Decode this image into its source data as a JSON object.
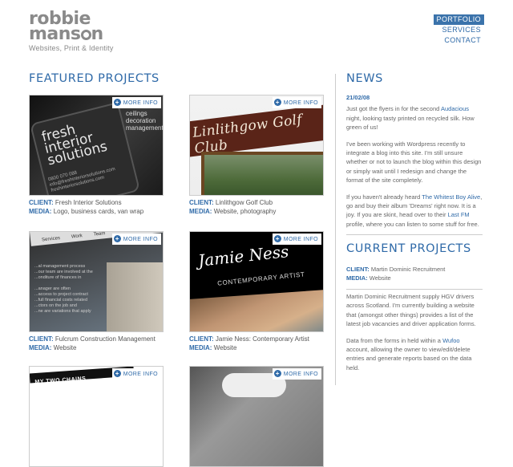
{
  "logo": {
    "line1": "robbie",
    "line2_before": "mans",
    "line2_after": "n",
    "tagline": "Websites, Print & Identity"
  },
  "nav": {
    "items": [
      {
        "label": "PORTFOLIO",
        "active": true
      },
      {
        "label": "SERVICES",
        "active": false
      },
      {
        "label": "CONTACT",
        "active": false
      }
    ]
  },
  "featured": {
    "title": "FEATURED PROJECTS",
    "more_info": "MORE INFO",
    "client_label": "CLIENT:",
    "media_label": "MEDIA:",
    "projects": [
      {
        "client": "Fresh Interior Solutions",
        "media": "Logo, business cards, van wrap",
        "art": {
          "t1": "fresh\ninterior\nsolutions",
          "t2": "0800 070 088\ninfo@freshinteriorsolutions.com\nfreshinteriorsolutions.com",
          "t3": "ceilings\ndecoration\nmanagement"
        }
      },
      {
        "client": "Linlithgow Golf Club",
        "media": "Website, photography",
        "art": {
          "script": "Linlithgow Golf Club"
        }
      },
      {
        "client": "Fulcrum Construction Management",
        "media": "Website",
        "art": {
          "tabs": [
            "Services",
            "Work",
            "Team"
          ],
          "lines": "...al management process\n...our team are involved at the\n...onditure of finances in\n\n...anager are often\n...access to project contract\n...full financial costs related\n...ctors on the job and\n...ne are variations that apply"
        }
      },
      {
        "client": "Jamie Ness: Contemporary Artist",
        "media": "Website",
        "art": {
          "sig": "Jamie Ness",
          "sub": "CONTEMPORARY ARTIST"
        }
      },
      {
        "art": {
          "stripe": "MY TWO CHAINS"
        }
      },
      {
        "art": {}
      }
    ]
  },
  "news": {
    "title": "NEWS",
    "date": "21/02/08",
    "p1_a": "Just got the flyers in for the second ",
    "p1_link": "Audacious",
    "p1_b": " night, looking tasty printed on recycled silk. How green of us!",
    "p2": "I've been working with Wordpress recently to integrate a blog into this site. I'm still unsure whether or not to launch the blog within this design or simply wait until I redesign and change the format of the site completely.",
    "p3_a": "If you haven't already heard ",
    "p3_link1": "The Whitest Boy Alive",
    "p3_b": ", go and buy their album 'Dreams' right now. It is a joy. If you are skint, head over to their ",
    "p3_link2": "Last FM",
    "p3_c": " profile, where you can listen to some stuff for free."
  },
  "current": {
    "title": "CURRENT PROJECTS",
    "client_label": "CLIENT:",
    "client": "Martin Dominic Recruitment",
    "media_label": "MEDIA:",
    "media": "Website",
    "p1": "Martin Dominic Recruitment supply HGV drivers across Scotland. I'm currently building a website that (amongst other things) provides a list of the latest job vacancies and driver application forms.",
    "p2_a": "Data from the forms in held within a ",
    "p2_link": "Wufoo",
    "p2_b": " account, allowing the owner to view/edit/delete entries and generate reports based on the data held."
  },
  "colors": {
    "accent": "#2f6aa8",
    "nav_active_bg": "#3b73ab",
    "logo_grey": "#8a8a8a"
  }
}
